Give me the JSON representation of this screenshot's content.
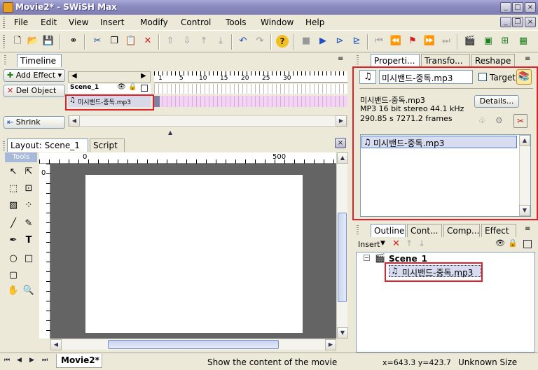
{
  "window": {
    "title": "Movie2* - SWiSH Max"
  },
  "menu": [
    "File",
    "Edit",
    "View",
    "Insert",
    "Modify",
    "Control",
    "Tools",
    "Window",
    "Help"
  ],
  "timeline": {
    "tab": "Timeline",
    "add_effect": "Add Effect",
    "del_object": "Del Object",
    "shrink": "Shrink",
    "scene_row": "Scene_1",
    "sound_row": "미시밴드-중독.mp3",
    "ruler": [
      "1",
      "5",
      "10",
      "15",
      "20",
      "25",
      "30"
    ]
  },
  "layout": {
    "tab_layout": "Layout: Scene_1",
    "tab_script": "Script",
    "tools_label": "Tools",
    "ruler_h": [
      "0",
      "500"
    ],
    "ruler_v": [
      "0"
    ]
  },
  "properties": {
    "tabs": [
      "Properti...",
      "Transfo...",
      "Reshape"
    ],
    "name_value": "미시밴드-중독.mp3",
    "target_label": "Target",
    "info_name": "미시밴드-중독.mp3",
    "info_format": "MP3 16 bit stereo 44.1 kHz",
    "info_duration": "290.85 s 7271.2 frames",
    "details_button": "Details...",
    "list_item": "미시밴드-중독.mp3"
  },
  "outline": {
    "tabs": [
      "Outline",
      "Cont...",
      "Comp...",
      "Effect"
    ],
    "insert_label": "Insert",
    "scene": "Scene_1",
    "sound": "미시밴드-중독.mp3"
  },
  "status": {
    "doc_tab": "Movie2*",
    "message": "Show the content of the movie",
    "coords": "x=643.3 y=423.7",
    "size": "Unknown Size"
  }
}
